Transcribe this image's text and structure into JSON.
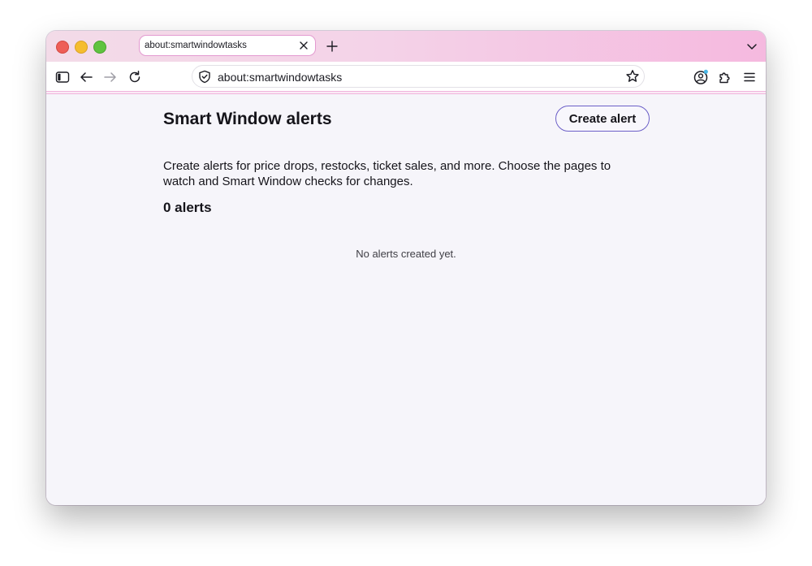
{
  "window": {
    "controls": [
      "close",
      "minimize",
      "zoom"
    ]
  },
  "tabs": [
    {
      "title": "about:smartwindowtasks",
      "active": true
    }
  ],
  "toolbar": {
    "url": "about:smartwindowtasks",
    "icons": {
      "sidebar": "sidebar-icon",
      "back": "arrow-left-icon",
      "forward": "arrow-right-icon",
      "reload": "reload-icon",
      "shield": "shield-icon",
      "bookmark": "star-icon",
      "account": "account-icon",
      "extensions": "puzzle-icon",
      "menu": "hamburger-icon"
    }
  },
  "page": {
    "title": "Smart Window alerts",
    "create_button_label": "Create alert",
    "description": "Create alerts for price drops, restocks, ticket sales, and more. Choose the pages to watch and Smart Window checks for changes.",
    "alert_count": "0 alerts",
    "empty_message": "No alerts created yet."
  },
  "colors": {
    "accent": "#6b5fc7",
    "tabstrip_start": "#f3dbe8",
    "tabstrip_end": "#f5b9df",
    "notification_dot": "#4ab8e8"
  }
}
